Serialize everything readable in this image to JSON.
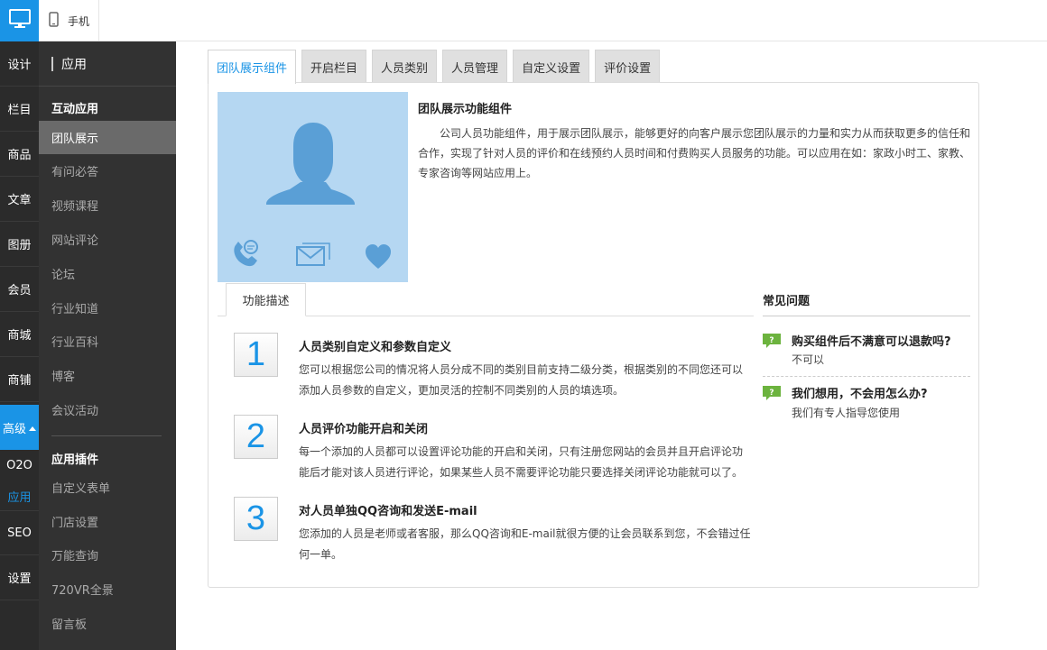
{
  "topbar": {
    "mobile_label": "手机"
  },
  "rail": {
    "items": [
      "设计",
      "栏目",
      "商品",
      "文章",
      "图册",
      "会员",
      "商城",
      "商铺",
      "高级"
    ],
    "sub_items": [
      "O2O",
      "应用",
      "SEO",
      "设置"
    ],
    "active_color": "#1a94e6"
  },
  "sidebar": {
    "header": "应用",
    "group1": "互动应用",
    "items1": [
      "团队展示",
      "有问必答",
      "视频课程",
      "网站评论",
      "论坛",
      "行业知道",
      "行业百科",
      "博客",
      "会议活动"
    ],
    "group2": "应用插件",
    "items2": [
      "自定义表单",
      "门店设置",
      "万能查询",
      "720VR全景",
      "留言板"
    ]
  },
  "tabs": [
    "团队展示组件",
    "开启栏目",
    "人员类别",
    "人员管理",
    "自定义设置",
    "评价设置"
  ],
  "intro": {
    "title": "团队展示功能组件",
    "desc": "公司人员功能组件，用于展示团队展示，能够更好的向客户展示您团队展示的力量和实力从而获取更多的信任和合作，实现了针对人员的评价和在线预约人员时间和付费购买人员服务的功能。可以应用在如：家政小时工、家教、专家咨询等网站应用上。"
  },
  "features_tab": "功能描述",
  "features": [
    {
      "num": "1",
      "title": "人员类别自定义和参数自定义",
      "desc": "您可以根据您公司的情况将人员分成不同的类别目前支持二级分类，根据类别的不同您还可以添加人员参数的自定义，更加灵活的控制不同类别的人员的填选项。"
    },
    {
      "num": "2",
      "title": "人员评价功能开启和关闭",
      "desc": "每一个添加的人员都可以设置评论功能的开启和关闭，只有注册您网站的会员并且开启评论功能后才能对该人员进行评论，如果某些人员不需要评论功能只要选择关闭评论功能就可以了。"
    },
    {
      "num": "3",
      "title": "对人员单独QQ咨询和发送E-mail",
      "desc": "您添加的人员是老师或者客服，那么QQ咨询和E-mail就很方便的让会员联系到您，不会错过任何一单。"
    }
  ],
  "faq": {
    "title": "常见问题",
    "items": [
      {
        "q": "购买组件后不满意可以退款吗?",
        "a": "不可以"
      },
      {
        "q": "我们想用，不会用怎么办?",
        "a": "我们有专人指导您使用"
      }
    ]
  }
}
